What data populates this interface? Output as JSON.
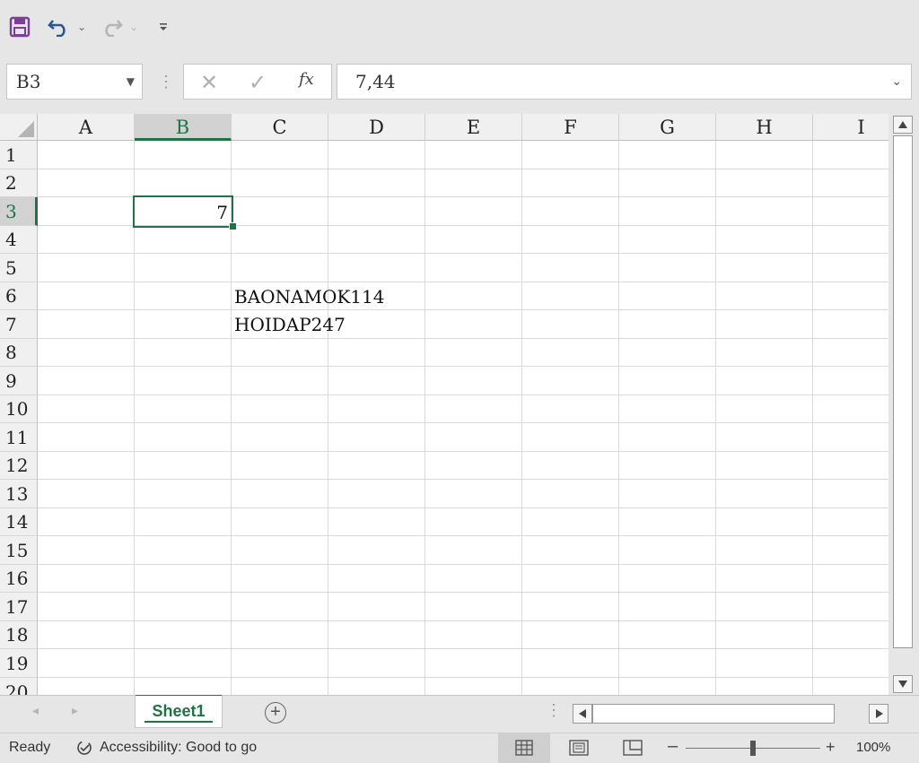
{
  "name_box": {
    "value": "B3"
  },
  "formula_bar": {
    "value": "7,44",
    "fx_label": "fx"
  },
  "columns": [
    "A",
    "B",
    "C",
    "D",
    "E",
    "F",
    "G",
    "H",
    "I"
  ],
  "rows": [
    "1",
    "2",
    "3",
    "4",
    "5",
    "6",
    "7",
    "8",
    "9",
    "10",
    "11",
    "12",
    "13",
    "14",
    "15",
    "16",
    "17",
    "18",
    "19",
    "20"
  ],
  "selected_cell": {
    "column": "B",
    "row": "3",
    "display_value": "7"
  },
  "cells": {
    "C6": "BAONAMOK114",
    "C7": "HOIDAP247"
  },
  "sheet_tabs": [
    {
      "label": "Sheet1",
      "active": true
    }
  ],
  "status": {
    "ready": "Ready",
    "accessibility": "Accessibility: Good to go",
    "zoom": "100%"
  },
  "colors": {
    "accent": "#217346",
    "save_icon": "#7b3f98",
    "undo": "#2b5797"
  }
}
